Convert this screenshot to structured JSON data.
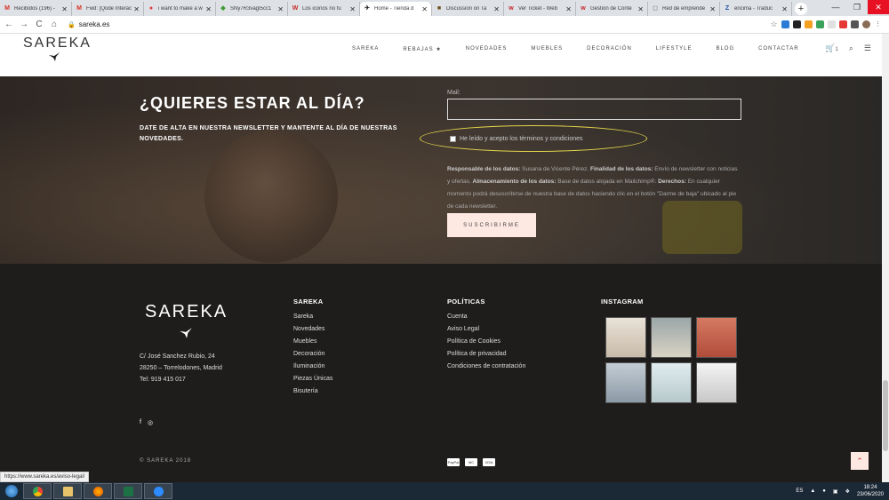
{
  "browser": {
    "tabs": [
      {
        "title": "Recibidos (196) -",
        "color": "#d93025",
        "glyph": "M"
      },
      {
        "title": "Fwd: [Qode Interac",
        "color": "#d93025",
        "glyph": "M"
      },
      {
        "title": "i want to make a w",
        "color": "#e53935",
        "glyph": "●"
      },
      {
        "title": "SNy7R3vagI5cc1",
        "color": "#3f9c35",
        "glyph": "◆"
      },
      {
        "title": "Los iconos no fu",
        "color": "#c62828",
        "glyph": "W"
      },
      {
        "title": "Home - Tienda d",
        "color": "#222222",
        "glyph": "✈",
        "active": true
      },
      {
        "title": "Discussion on Ta",
        "color": "#6b4f1d",
        "glyph": "■"
      },
      {
        "title": "Ver Ticket - Web",
        "color": "#c62828",
        "glyph": "w"
      },
      {
        "title": "Gestión de Conte",
        "color": "#c62828",
        "glyph": "w"
      },
      {
        "title": "Red de emprende",
        "color": "#999999",
        "glyph": "◻"
      },
      {
        "title": "encima - Traduc",
        "color": "#1a4fa0",
        "glyph": "Z"
      }
    ],
    "url": "sareka.es",
    "status_url": "https://www.sareka.es/aviso-legal/"
  },
  "header": {
    "logo": "SAREKA",
    "nav": [
      "SAREKA",
      "REBAJAS ★",
      "NOVEDADES",
      "MUEBLES",
      "DECORACIÓN",
      "LIFESTYLE",
      "BLOG",
      "CONTACTAR"
    ],
    "cart_count": "1"
  },
  "newsletter": {
    "title": "¿QUIERES ESTAR AL DÍA?",
    "subtitle": "DATE DE ALTA EN NUESTRA NEWSLETTER Y MANTENTE AL DÍA DE NUESTRAS NOVEDADES.",
    "mail_label": "Mail:",
    "mail_value": "",
    "checkbox_label": "He leído y acepto los términos y condiciones",
    "legal": {
      "l1": "Responsable de los datos:",
      "v1": " Susana de Vicente Pérez. ",
      "l2": "Finalidad de los datos:",
      "v2": " Envío de newsletter con noticias y ofertas. ",
      "l3": "Almacenamiento de los datos:",
      "v3": " Base de datos alojada en Mailchimp®. ",
      "l4": "Derechos:",
      "v4": " En cualquier momento podrá desuscribirse de nuestra base de datos haciendo clic en el botón \"Darme de baja\" ubicado al pie de cada newsletter."
    },
    "button": "SUSCRIBIRME"
  },
  "footer": {
    "logo": "SAREKA",
    "address": [
      "C/ José Sanchez Rubio, 24",
      "28250 – Torrelodones, Madrid",
      "Tel: 919 415 017"
    ],
    "col1": {
      "title": "SAREKA",
      "links": [
        "Sareka",
        "Novedades",
        "Muebles",
        "Decoración",
        "Iluminación",
        "Piezas Únicas",
        "Bisutería"
      ]
    },
    "col2": {
      "title": "POLÍTICAS",
      "links": [
        "Cuenta",
        "Aviso Legal",
        "Política de Cookies",
        "Política de privacidad",
        "Condiciones de contratación"
      ]
    },
    "instagram_title": "INSTAGRAM",
    "copyright": "© SAREKA 2018",
    "payments": [
      "PayPal",
      "MC",
      "VISA"
    ]
  },
  "taskbar": {
    "lang": "ES",
    "time": "18:24",
    "date": "23/06/2020"
  }
}
